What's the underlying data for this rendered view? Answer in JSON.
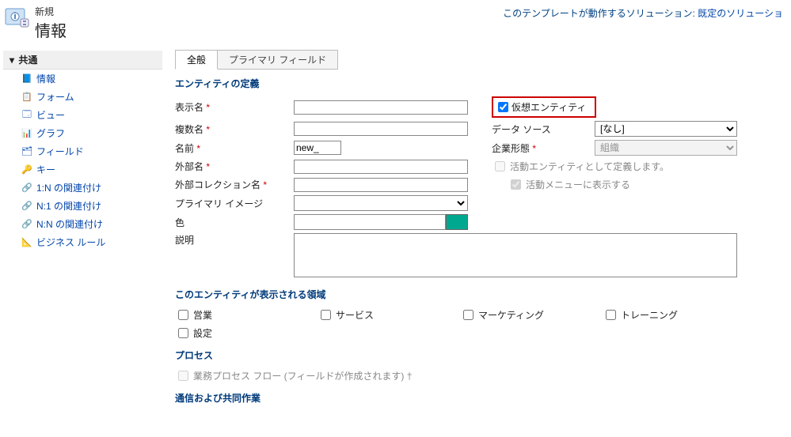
{
  "header": {
    "small": "新規",
    "big": "情報",
    "rightPrefix": "このテンプレートが動作するソリューション:",
    "solutionName": "既定のソリューショ"
  },
  "sidebar": {
    "groupTitle": "共通",
    "items": [
      {
        "label": "情報",
        "icon": "info"
      },
      {
        "label": "フォーム",
        "icon": "form"
      },
      {
        "label": "ビュー",
        "icon": "view"
      },
      {
        "label": "グラフ",
        "icon": "chart"
      },
      {
        "label": "フィールド",
        "icon": "field"
      },
      {
        "label": "キー",
        "icon": "key"
      },
      {
        "label": "1:N の関連付け",
        "icon": "rel1n"
      },
      {
        "label": "N:1 の関連付け",
        "icon": "reln1"
      },
      {
        "label": "N:N の関連付け",
        "icon": "relnn"
      },
      {
        "label": "ビジネス ルール",
        "icon": "rule"
      }
    ]
  },
  "tabs": {
    "general": "全般",
    "primary": "プライマリ フィールド"
  },
  "sections": {
    "definition": "エンティティの定義",
    "areas": "このエンティティが表示される領域",
    "process": "プロセス",
    "comm": "通信および共同作業"
  },
  "fields": {
    "displayName": {
      "label": "表示名",
      "value": ""
    },
    "pluralName": {
      "label": "複数名",
      "value": ""
    },
    "name": {
      "label": "名前",
      "value": "new_"
    },
    "externalName": {
      "label": "外部名",
      "value": ""
    },
    "externalCollection": {
      "label": "外部コレクション名",
      "value": ""
    },
    "primaryImage": {
      "label": "プライマリ イメージ",
      "value": ""
    },
    "color": {
      "label": "色",
      "value": ""
    },
    "description": {
      "label": "説明",
      "value": ""
    },
    "virtualEntity": {
      "label": "仮想エンティティ",
      "checked": true
    },
    "dataSource": {
      "label": "データ ソース",
      "value": "[なし]"
    },
    "ownership": {
      "label": "企業形態",
      "value": "組織"
    },
    "defineAsActivity": {
      "label": "活動エンティティとして定義します。",
      "checked": false
    },
    "showInActivityMenu": {
      "label": "活動メニューに表示する",
      "checked": true
    }
  },
  "areas": {
    "sales": {
      "label": "営業",
      "checked": false
    },
    "service": {
      "label": "サービス",
      "checked": false
    },
    "marketing": {
      "label": "マーケティング",
      "checked": false
    },
    "training": {
      "label": "トレーニング",
      "checked": false
    },
    "settings": {
      "label": "設定",
      "checked": false
    }
  },
  "process": {
    "bpf": {
      "label": "業務プロセス フロー (フィールドが作成されます) †",
      "checked": false
    }
  }
}
